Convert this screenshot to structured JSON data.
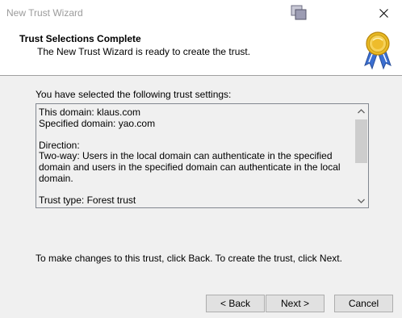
{
  "window": {
    "title": "New Trust Wizard"
  },
  "header": {
    "title": "Trust Selections Complete",
    "subtitle": "The New Trust Wizard is ready to create the trust."
  },
  "body": {
    "intro": "You have selected the following trust settings:",
    "summary": {
      "this_domain": "This domain: klaus.com",
      "specified_domain": "Specified domain: yao.com",
      "direction_label": "Direction:",
      "direction_text": "Two-way: Users in the local domain can authenticate in the specified domain and users in the specified domain can authenticate in the local domain.",
      "trust_type": "Trust type: Forest trust"
    },
    "footer": "To make changes to this trust, click Back. To create the trust, click Next."
  },
  "buttons": {
    "back": "< Back",
    "next": "Next >",
    "cancel": "Cancel"
  },
  "icons": {
    "app": "wizard-app-icon",
    "close": "close-icon",
    "badge": "award-ribbon-icon",
    "scroll_up": "chevron-up-icon",
    "scroll_down": "chevron-down-icon"
  }
}
